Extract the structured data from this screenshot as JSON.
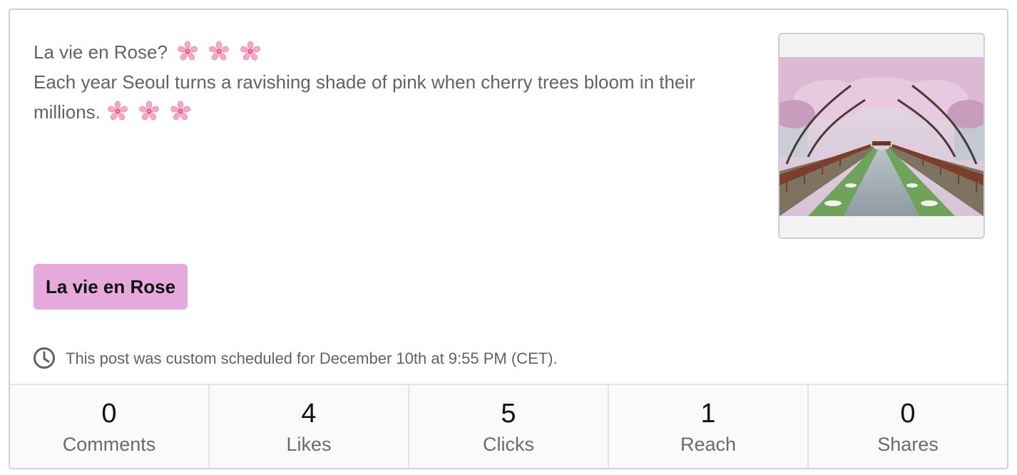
{
  "post": {
    "title_line": "La vie en Rose?",
    "body_line": "Each year Seoul turns a ravishing shade of pink when cherry trees bloom in their",
    "body_line2": "millions.",
    "emoji": "cherry-blossom-icon"
  },
  "tag": {
    "label": "La vie en Rose",
    "color": "#e6a9db"
  },
  "schedule": {
    "icon": "clock-icon",
    "text": "This post was custom scheduled for December 10th at 9:55 PM (CET)."
  },
  "stats": [
    {
      "value": "0",
      "label": "Comments"
    },
    {
      "value": "4",
      "label": "Likes"
    },
    {
      "value": "5",
      "label": "Clicks"
    },
    {
      "value": "1",
      "label": "Reach"
    },
    {
      "value": "0",
      "label": "Shares"
    }
  ]
}
